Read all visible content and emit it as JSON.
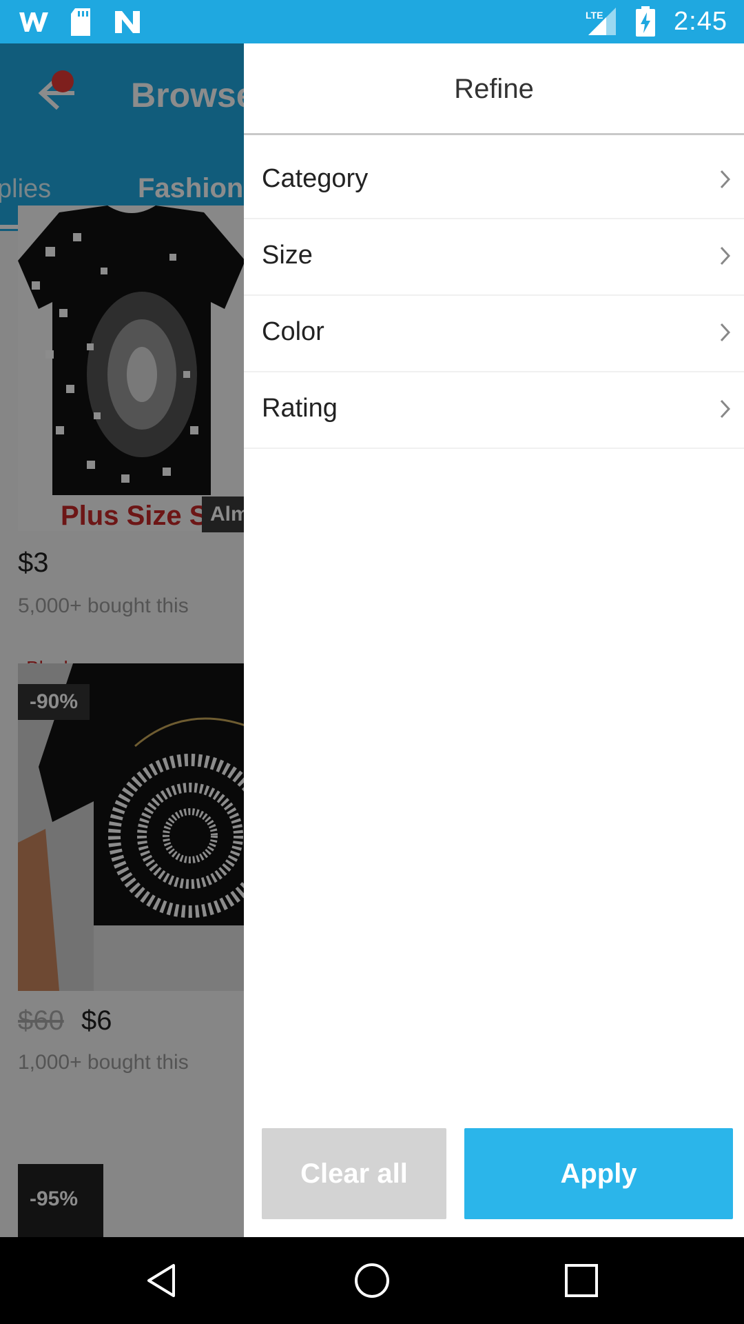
{
  "status_bar": {
    "time": "2:45",
    "network": "LTE",
    "icons": [
      "wish-icon",
      "sd-card-icon",
      "n-app-icon",
      "signal-icon",
      "battery-icon"
    ]
  },
  "background": {
    "title": "Browse",
    "tabs": [
      "plies",
      "Fashion"
    ],
    "products": [
      {
        "image_text": "Plus Size S-",
        "badge": "Alm",
        "price": "$3",
        "bought": "5,000+ bought this"
      },
      {
        "color_label": "Black",
        "discount": "-90%",
        "old_price": "$60",
        "price": "$6",
        "bought": "1,000+ bought this"
      },
      {
        "discount": "-95%"
      }
    ]
  },
  "drawer": {
    "title": "Refine",
    "filters": [
      {
        "label": "Category"
      },
      {
        "label": "Size"
      },
      {
        "label": "Color"
      },
      {
        "label": "Rating"
      }
    ],
    "clear_label": "Clear all",
    "apply_label": "Apply"
  },
  "colors": {
    "status_bar": "#1FA8E0",
    "apply": "#2BB5EA",
    "clear": "#D3D3D3",
    "accent_red": "#C62828"
  },
  "nav": {
    "icons": [
      "back-icon",
      "home-icon",
      "recents-icon"
    ]
  }
}
